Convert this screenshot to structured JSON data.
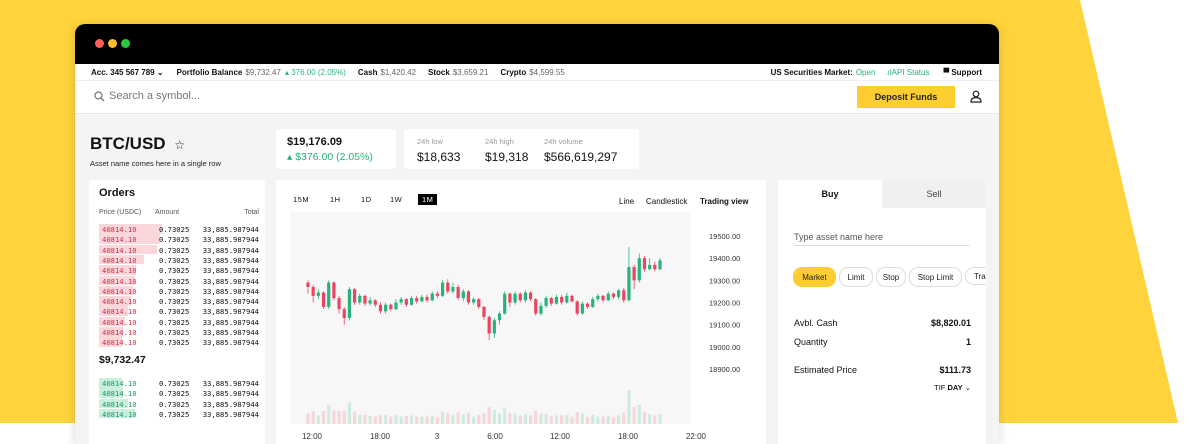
{
  "topbar": {
    "account": "Acc. 345 567 789",
    "portfolio_label": "Portfolio Balance",
    "portfolio_value": "$9,732.47",
    "portfolio_change": "376.00 (2.05%)",
    "cash_label": "Cash",
    "cash_value": "$1,420.42",
    "stock_label": "Stock",
    "stock_value": "$3,659.21",
    "crypto_label": "Crypto",
    "crypto_value": "$4,599.55",
    "market_label": "US Securities Market:",
    "market_status": "Open",
    "api_status": "API Status",
    "support": "Support"
  },
  "search": {
    "placeholder": "Search a symbol..."
  },
  "deposit_label": "Deposit Funds",
  "asset": {
    "symbol": "BTC/USD",
    "subtitle": "Asset name comes here in a single row",
    "price": "$19,176.09",
    "change": "$376.00 (2.05%)"
  },
  "stats": [
    {
      "label": "24h low",
      "value": "$18,633"
    },
    {
      "label": "24h high",
      "value": "$19,318"
    },
    {
      "label": "24h volume",
      "value": "$566,619,297"
    }
  ],
  "orders": {
    "title": "Orders",
    "headers": [
      "Price (USDC)",
      "Amount",
      "Total"
    ],
    "sell_rows": [
      {
        "price": "40814.10",
        "amount": "0.73025",
        "total": "33,885.987944",
        "depth": 0.88
      },
      {
        "price": "40814.10",
        "amount": "0.73025",
        "total": "33,885.987944",
        "depth": 0.85
      },
      {
        "price": "40814.10",
        "amount": "0.73025",
        "total": "33,885.987944",
        "depth": 0.8
      },
      {
        "price": "40814.10",
        "amount": "0.73025",
        "total": "33,885.987944",
        "depth": 0.62
      },
      {
        "price": "40814.10",
        "amount": "0.73025",
        "total": "33,885.987944",
        "depth": 0.52
      },
      {
        "price": "40814.10",
        "amount": "0.73025",
        "total": "33,885.987944",
        "depth": 0.5
      },
      {
        "price": "40814.10",
        "amount": "0.73025",
        "total": "33,885.987944",
        "depth": 0.47
      },
      {
        "price": "40814.10",
        "amount": "0.73025",
        "total": "33,885.987944",
        "depth": 0.45
      },
      {
        "price": "40814.10",
        "amount": "0.73025",
        "total": "33,885.987944",
        "depth": 0.4
      },
      {
        "price": "40814.10",
        "amount": "0.73025",
        "total": "33,885.987944",
        "depth": 0.36
      },
      {
        "price": "40814.10",
        "amount": "0.73025",
        "total": "33,885.987944",
        "depth": 0.34
      },
      {
        "price": "40814.10",
        "amount": "0.73025",
        "total": "33,885.987944",
        "depth": 0.32
      }
    ],
    "mid_price": "$9,732.47",
    "buy_rows": [
      {
        "price": "40814.10",
        "amount": "0.73025",
        "total": "33,885.987944",
        "depth": 0.32
      },
      {
        "price": "40814.10",
        "amount": "0.73025",
        "total": "33,885.987944",
        "depth": 0.34
      },
      {
        "price": "40814.10",
        "amount": "0.73025",
        "total": "33,885.987944",
        "depth": 0.4
      },
      {
        "price": "40814.10",
        "amount": "0.73025",
        "total": "33,885.987944",
        "depth": 0.5
      }
    ]
  },
  "chart": {
    "timeframes": [
      "15M",
      "1H",
      "1D",
      "1W",
      "1M"
    ],
    "active_timeframe": "1M",
    "views": [
      "Line",
      "Candlestick",
      "Trading view"
    ],
    "active_view": "Trading view"
  },
  "chart_data": {
    "type": "candlestick",
    "y_ticks": [
      "19500.00",
      "19400.00",
      "19300.00",
      "19200.00",
      "19100.00",
      "19000.00",
      "18900.00"
    ],
    "ylim": [
      18900,
      19500
    ],
    "x_ticks": [
      "12:00",
      "18:00",
      "3",
      "6:00",
      "12:00",
      "18:00",
      "22:00"
    ],
    "candles": [
      {
        "o": 19290,
        "c": 19270,
        "h": 19300,
        "l": 19240
      },
      {
        "o": 19270,
        "c": 19230,
        "h": 19280,
        "l": 19200
      },
      {
        "o": 19230,
        "c": 19245,
        "h": 19260,
        "l": 19215
      },
      {
        "o": 19245,
        "c": 19180,
        "h": 19250,
        "l": 19170
      },
      {
        "o": 19180,
        "c": 19290,
        "h": 19300,
        "l": 19170
      },
      {
        "o": 19290,
        "c": 19220,
        "h": 19295,
        "l": 19210
      },
      {
        "o": 19220,
        "c": 19170,
        "h": 19230,
        "l": 19150
      },
      {
        "o": 19170,
        "c": 19130,
        "h": 19180,
        "l": 19100
      },
      {
        "o": 19130,
        "c": 19260,
        "h": 19270,
        "l": 19120
      },
      {
        "o": 19260,
        "c": 19200,
        "h": 19265,
        "l": 19190
      },
      {
        "o": 19200,
        "c": 19230,
        "h": 19240,
        "l": 19190
      },
      {
        "o": 19230,
        "c": 19195,
        "h": 19235,
        "l": 19185
      },
      {
        "o": 19195,
        "c": 19210,
        "h": 19225,
        "l": 19185
      },
      {
        "o": 19210,
        "c": 19190,
        "h": 19215,
        "l": 19180
      },
      {
        "o": 19190,
        "c": 19160,
        "h": 19200,
        "l": 19150
      },
      {
        "o": 19160,
        "c": 19190,
        "h": 19200,
        "l": 19150
      },
      {
        "o": 19190,
        "c": 19170,
        "h": 19195,
        "l": 19160
      },
      {
        "o": 19170,
        "c": 19200,
        "h": 19215,
        "l": 19165
      },
      {
        "o": 19200,
        "c": 19215,
        "h": 19225,
        "l": 19190
      },
      {
        "o": 19215,
        "c": 19190,
        "h": 19220,
        "l": 19180
      },
      {
        "o": 19190,
        "c": 19220,
        "h": 19230,
        "l": 19185
      },
      {
        "o": 19220,
        "c": 19205,
        "h": 19230,
        "l": 19195
      },
      {
        "o": 19205,
        "c": 19225,
        "h": 19235,
        "l": 19200
      },
      {
        "o": 19225,
        "c": 19210,
        "h": 19235,
        "l": 19200
      },
      {
        "o": 19210,
        "c": 19240,
        "h": 19250,
        "l": 19205
      },
      {
        "o": 19240,
        "c": 19230,
        "h": 19250,
        "l": 19220
      },
      {
        "o": 19230,
        "c": 19290,
        "h": 19300,
        "l": 19225
      },
      {
        "o": 19290,
        "c": 19250,
        "h": 19305,
        "l": 19240
      },
      {
        "o": 19250,
        "c": 19270,
        "h": 19290,
        "l": 19240
      },
      {
        "o": 19270,
        "c": 19220,
        "h": 19280,
        "l": 19210
      },
      {
        "o": 19220,
        "c": 19250,
        "h": 19260,
        "l": 19205
      },
      {
        "o": 19250,
        "c": 19200,
        "h": 19255,
        "l": 19190
      },
      {
        "o": 19200,
        "c": 19215,
        "h": 19225,
        "l": 19190
      },
      {
        "o": 19215,
        "c": 19180,
        "h": 19220,
        "l": 19170
      },
      {
        "o": 19180,
        "c": 19135,
        "h": 19185,
        "l": 19120
      },
      {
        "o": 19135,
        "c": 19060,
        "h": 19140,
        "l": 19030
      },
      {
        "o": 19060,
        "c": 19120,
        "h": 19130,
        "l": 19040
      },
      {
        "o": 19120,
        "c": 19150,
        "h": 19160,
        "l": 19100
      },
      {
        "o": 19150,
        "c": 19240,
        "h": 19250,
        "l": 19145
      },
      {
        "o": 19240,
        "c": 19200,
        "h": 19245,
        "l": 19180
      },
      {
        "o": 19200,
        "c": 19240,
        "h": 19250,
        "l": 19190
      },
      {
        "o": 19240,
        "c": 19210,
        "h": 19245,
        "l": 19200
      },
      {
        "o": 19210,
        "c": 19245,
        "h": 19255,
        "l": 19200
      },
      {
        "o": 19245,
        "c": 19215,
        "h": 19250,
        "l": 19205
      },
      {
        "o": 19215,
        "c": 19150,
        "h": 19220,
        "l": 19140
      },
      {
        "o": 19150,
        "c": 19185,
        "h": 19200,
        "l": 19140
      },
      {
        "o": 19185,
        "c": 19220,
        "h": 19230,
        "l": 19175
      },
      {
        "o": 19220,
        "c": 19195,
        "h": 19225,
        "l": 19185
      },
      {
        "o": 19195,
        "c": 19225,
        "h": 19235,
        "l": 19190
      },
      {
        "o": 19225,
        "c": 19200,
        "h": 19235,
        "l": 19190
      },
      {
        "o": 19200,
        "c": 19230,
        "h": 19245,
        "l": 19195
      },
      {
        "o": 19230,
        "c": 19205,
        "h": 19235,
        "l": 19200
      },
      {
        "o": 19205,
        "c": 19150,
        "h": 19210,
        "l": 19140
      },
      {
        "o": 19150,
        "c": 19195,
        "h": 19205,
        "l": 19145
      },
      {
        "o": 19195,
        "c": 19180,
        "h": 19200,
        "l": 19170
      },
      {
        "o": 19180,
        "c": 19215,
        "h": 19225,
        "l": 19175
      },
      {
        "o": 19215,
        "c": 19230,
        "h": 19240,
        "l": 19205
      },
      {
        "o": 19230,
        "c": 19210,
        "h": 19235,
        "l": 19200
      },
      {
        "o": 19210,
        "c": 19240,
        "h": 19250,
        "l": 19205
      },
      {
        "o": 19240,
        "c": 19225,
        "h": 19245,
        "l": 19215
      },
      {
        "o": 19225,
        "c": 19255,
        "h": 19260,
        "l": 19215
      },
      {
        "o": 19255,
        "c": 19210,
        "h": 19265,
        "l": 19200
      },
      {
        "o": 19210,
        "c": 19360,
        "h": 19450,
        "l": 19205
      },
      {
        "o": 19360,
        "c": 19300,
        "h": 19370,
        "l": 19260
      },
      {
        "o": 19300,
        "c": 19400,
        "h": 19420,
        "l": 19290
      },
      {
        "o": 19400,
        "c": 19350,
        "h": 19410,
        "l": 19340
      },
      {
        "o": 19350,
        "c": 19370,
        "h": 19400,
        "l": 19345
      },
      {
        "o": 19370,
        "c": 19350,
        "h": 19385,
        "l": 19340
      },
      {
        "o": 19350,
        "c": 19390,
        "h": 19400,
        "l": 19345
      }
    ]
  },
  "trade": {
    "tabs": [
      "Buy",
      "Sell"
    ],
    "active_tab": "Buy",
    "asset_placeholder": "Type asset name here",
    "order_types": [
      "Market",
      "Limit",
      "Stop",
      "Stop Limit",
      "Tra"
    ],
    "active_order_type": "Market",
    "avbl_label": "Avbl. Cash",
    "avbl_value": "$8,820.01",
    "qty_label": "Quantity",
    "qty_value": "1",
    "est_label": "Estimated Price",
    "est_value": "$111.73",
    "tif_label": "TIF",
    "tif_value": "DAY"
  },
  "colors": {
    "accent": "#fecd2f",
    "up": "#27b37b",
    "down": "#e94560"
  }
}
